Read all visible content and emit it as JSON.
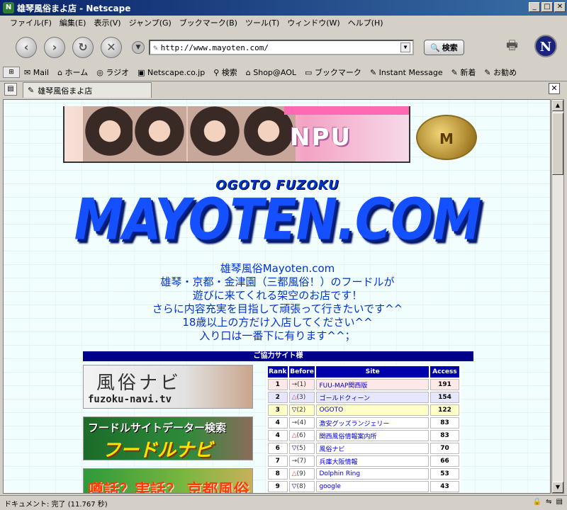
{
  "window": {
    "title": "雄琴風俗まよ店 - Netscape"
  },
  "menu": [
    "ファイル(F)",
    "編集(E)",
    "表示(V)",
    "ジャンプ(G)",
    "ブックマーク(B)",
    "ツール(T)",
    "ウィンドウ(W)",
    "ヘルプ(H)"
  ],
  "nav": {
    "url": "http://www.mayoten.com/",
    "search_label": "検索"
  },
  "personal_toolbar": [
    "Mail",
    "ホーム",
    "ラジオ",
    "Netscape.co.jp",
    "検索",
    "Shop@AOL",
    "ブックマーク",
    "Instant Message",
    "新着",
    "お勧め"
  ],
  "tab": {
    "title": "雄琴風俗まよ店"
  },
  "page": {
    "banner_text": "NPU",
    "seal_text": "M",
    "subtitle": "OGOTO FUZOKU",
    "logo": "MAYOTEN.COM",
    "intro": [
      "雄琴風俗Mayoten.com",
      "雄琴・京都・金津園（三都風俗！）のフードルが",
      "遊びに来てくれる架空のお店です！",
      "さらに内容充実を目指して頑張って行きたいです^^",
      "18歳以上の方だけ入店してください^^",
      "入り口は一番下に有ります^^；"
    ],
    "coop_title": "ご協力サイト様",
    "ads": [
      {
        "big": "風俗ナビ",
        "small": "fuzoku-navi.tv"
      },
      {
        "big": "フードルサイトデーター検索",
        "small": "フードルナビ"
      },
      {
        "big": "噂話？実話？ 京都風俗情報"
      }
    ],
    "ranking": {
      "headers": [
        "Rank",
        "Before",
        "Site",
        "Access"
      ],
      "rows": [
        {
          "rank": "1",
          "mark": "→",
          "before": "(1)",
          "site": "FUU-MAP関西版",
          "access": "191",
          "style": "pink"
        },
        {
          "rank": "2",
          "mark": "△",
          "before": "(3)",
          "site": "ゴールドクィーン",
          "access": "154",
          "style": "blue"
        },
        {
          "rank": "3",
          "mark": "▽",
          "before": "(2)",
          "site": "OGOTO",
          "access": "122",
          "style": "yel"
        },
        {
          "rank": "4",
          "mark": "→",
          "before": "(4)",
          "site": "激安グッズランジェリー",
          "access": "83",
          "style": ""
        },
        {
          "rank": "4",
          "mark": "△",
          "before": "(6)",
          "site": "関西風俗情報案内所",
          "access": "83",
          "style": ""
        },
        {
          "rank": "6",
          "mark": "▽",
          "before": "(5)",
          "site": "風俗ナビ",
          "access": "70",
          "style": ""
        },
        {
          "rank": "7",
          "mark": "→",
          "before": "(7)",
          "site": "兵庫大阪情報",
          "access": "66",
          "style": ""
        },
        {
          "rank": "8",
          "mark": "△",
          "before": "(9)",
          "site": "Dolphin Ring",
          "access": "53",
          "style": ""
        },
        {
          "rank": "9",
          "mark": "▽",
          "before": "(8)",
          "site": "google",
          "access": "43",
          "style": ""
        }
      ]
    }
  },
  "status": {
    "text": "ドキュメント: 完了 (11.767 秒)"
  }
}
